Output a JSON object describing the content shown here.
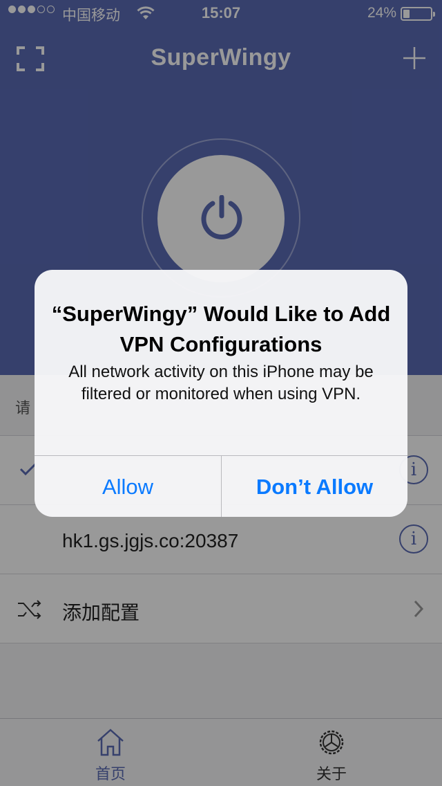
{
  "status_bar": {
    "carrier": "中国移动",
    "time": "15:07",
    "battery_percent": "24%",
    "battery_level": 0.24,
    "signal_bars": 3
  },
  "app": {
    "title": "SuperWingy"
  },
  "list": {
    "hint": "请",
    "servers": [
      {
        "label": "",
        "selected": true
      },
      {
        "label": "hk1.gs.jgjs.co:20387",
        "selected": false
      }
    ],
    "add_config_label": "添加配置"
  },
  "tabbar": {
    "home_label": "首页",
    "about_label": "关于"
  },
  "alert": {
    "title": "“SuperWingy” Would Like to Add VPN Configurations",
    "message": "All network activity on this iPhone may be filtered or monitored when using VPN.",
    "allow_label": "Allow",
    "deny_label": "Don’t Allow"
  },
  "colors": {
    "brand": "#5a6bb5",
    "ios_blue": "#0a7aff"
  }
}
